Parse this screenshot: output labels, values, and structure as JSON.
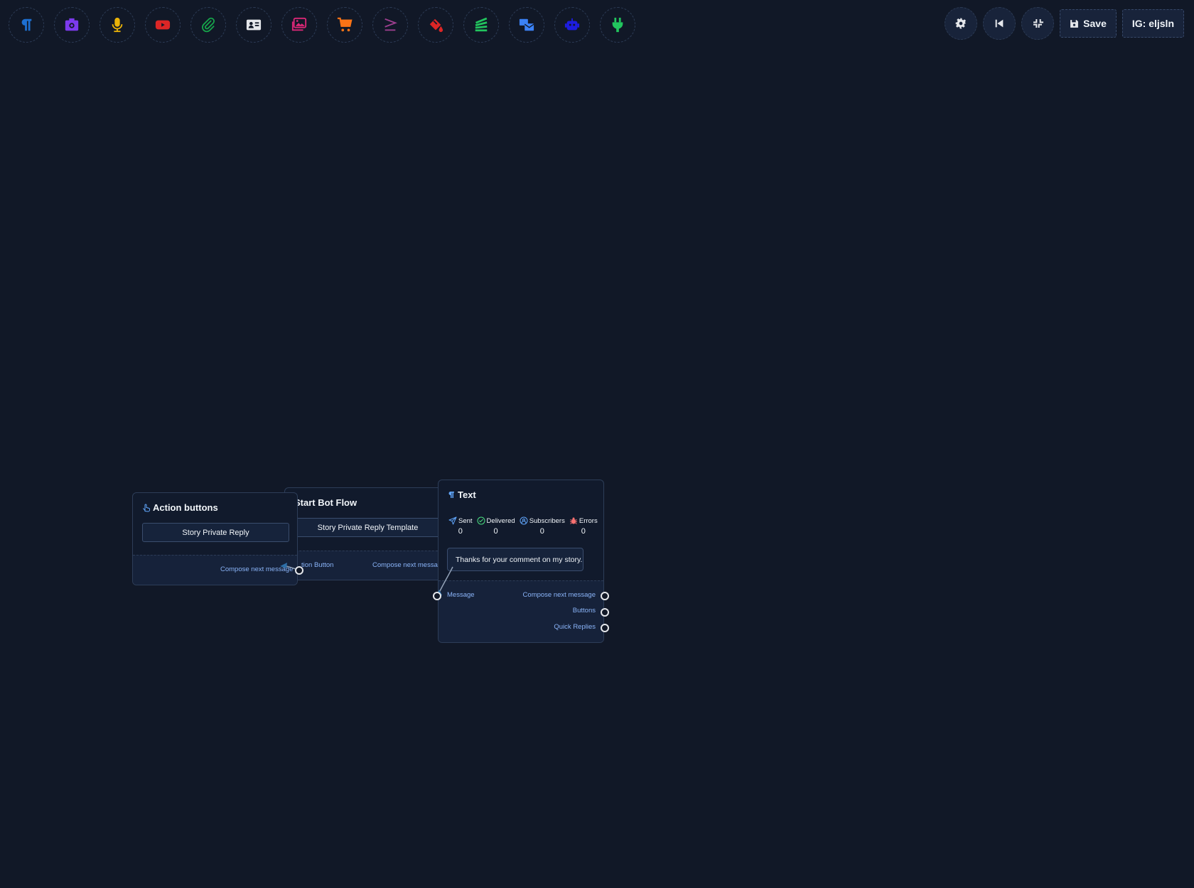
{
  "toolbar": {
    "tools": [
      {
        "name": "paragraph-icon",
        "color": "#1d6fd1"
      },
      {
        "name": "image-icon",
        "color": "#7c3aed"
      },
      {
        "name": "microphone-icon",
        "color": "#eab308"
      },
      {
        "name": "youtube-icon",
        "color": "#dc2626"
      },
      {
        "name": "paperclip-icon",
        "color": "#16a34a"
      },
      {
        "name": "id-card-icon",
        "color": "#e5e7eb"
      },
      {
        "name": "images-icon",
        "color": "#db2777"
      },
      {
        "name": "shopping-cart-icon",
        "color": "#f97316"
      },
      {
        "name": "greater-equal-icon",
        "color": "#9d3f8f"
      },
      {
        "name": "fill-drip-icon",
        "color": "#dc2626"
      },
      {
        "name": "layers-icon",
        "color": "#22c55e"
      },
      {
        "name": "mail-bulk-icon",
        "color": "#3b82f6"
      },
      {
        "name": "robot-icon",
        "color": "#1d1de0"
      },
      {
        "name": "plug-icon",
        "color": "#22c55e"
      }
    ]
  },
  "top_right": {
    "settings_icon": "gear-icon",
    "back_icon": "backward-step-icon",
    "fit_icon": "compress-icon",
    "save_label": "Save",
    "account_label": "IG: eljsln"
  },
  "nodes": {
    "action_buttons": {
      "title": "Action buttons",
      "button_label": "Story Private Reply",
      "output_label": "Compose next message"
    },
    "start_bot_flow": {
      "title": "Start Bot Flow",
      "template_label": "Story Private Reply Template",
      "input_label": "tion Button",
      "output_label": "Compose next messag"
    },
    "text": {
      "title": "Text",
      "stats": [
        {
          "label": "Sent",
          "value": "0",
          "icon": "paper-plane-icon",
          "color": "#60a5fa"
        },
        {
          "label": "Delivered",
          "value": "0",
          "icon": "check-circle-icon",
          "color": "#4ade80"
        },
        {
          "label": "Subscribers",
          "value": "0",
          "icon": "user-circle-icon",
          "color": "#60a5fa"
        },
        {
          "label": "Errors",
          "value": "0",
          "icon": "bug-icon",
          "color": "#f87171"
        }
      ],
      "message": "Thanks for your comment on my story.",
      "input_label": "Message",
      "outputs": [
        "Compose next message",
        "Buttons",
        "Quick Replies"
      ]
    }
  }
}
